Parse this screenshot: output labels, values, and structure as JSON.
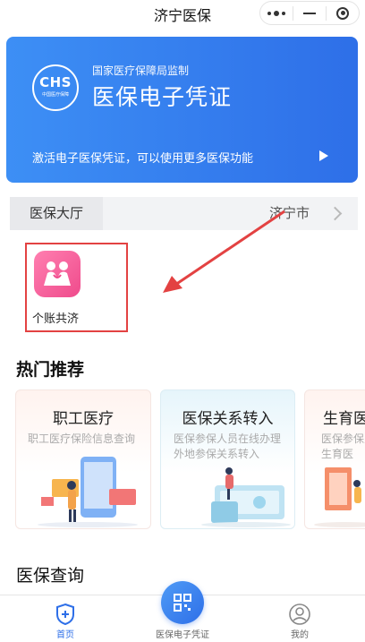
{
  "navbar": {
    "title": "济宁医保"
  },
  "banner": {
    "logo_text": "CHS",
    "logo_subtext": "中国医疗保障",
    "supervisor": "国家医疗保障局监制",
    "title": "医保电子凭证",
    "activate_text": "激活电子医保凭证，可以使用更多医保功能"
  },
  "hall": {
    "tab_label": "医保大厅",
    "city": "济宁市"
  },
  "services": [
    {
      "label": "个账共济",
      "icon": "family-icon"
    }
  ],
  "hot": {
    "title": "热门推荐",
    "cards": [
      {
        "title": "职工医疗",
        "desc": "职工医疗保险信息查询"
      },
      {
        "title": "医保关系转入",
        "desc": "医保参保人员在线办理外地参保关系转入"
      },
      {
        "title": "生育医",
        "desc": "医保参保人员在线办理生育医"
      }
    ]
  },
  "query": {
    "title": "医保查询"
  },
  "tabbar": {
    "items": [
      {
        "label": "首页",
        "icon": "shield-plus-icon",
        "active": true
      },
      {
        "label": "医保电子凭证",
        "icon": "qr-code-icon",
        "active": false
      },
      {
        "label": "我的",
        "icon": "user-icon",
        "active": false
      }
    ]
  },
  "colors": {
    "primary": "#2e6fe8",
    "pink": "#ef4b8c",
    "annotation_red": "#e34242"
  }
}
